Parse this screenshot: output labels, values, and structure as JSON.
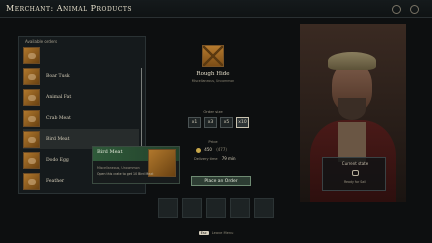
{
  "header": {
    "title": "Merchant: Animal Products"
  },
  "order_list": {
    "header": "Available orders",
    "items": [
      {
        "label": ""
      },
      {
        "label": "Boar Tusk"
      },
      {
        "label": "Animal Fat"
      },
      {
        "label": "Crab Meat"
      },
      {
        "label": "Bird Meat"
      },
      {
        "label": "Dodo Egg"
      },
      {
        "label": "Feather"
      }
    ]
  },
  "tooltip": {
    "title": "Bird Meat",
    "subtitle": "Miscellaneous, Uncommon",
    "description": "Open this crate to get 10 Bird Meat"
  },
  "detail": {
    "item_name": "Rough Hide",
    "item_subtitle": "Miscellaneous, Uncommon",
    "order_size_title": "Order size",
    "quantities": [
      "x1",
      "x3",
      "x5",
      "x10"
    ],
    "selected_quantity": "x10",
    "price_title": "Price",
    "price": "450",
    "price_owned": "(477)",
    "delivery_label": "Delivery time",
    "delivery_value": "79 min",
    "place_order": "Place an Order"
  },
  "crew_status": {
    "title": "Current state",
    "text": "Ready for Sail"
  },
  "footer": {
    "key": "Esc",
    "hint": "Leave Menu"
  },
  "colors": {
    "accent_green": "#2f5a3a",
    "crate_brown": "#b0772c",
    "coin_gold": "#c9a84a"
  }
}
